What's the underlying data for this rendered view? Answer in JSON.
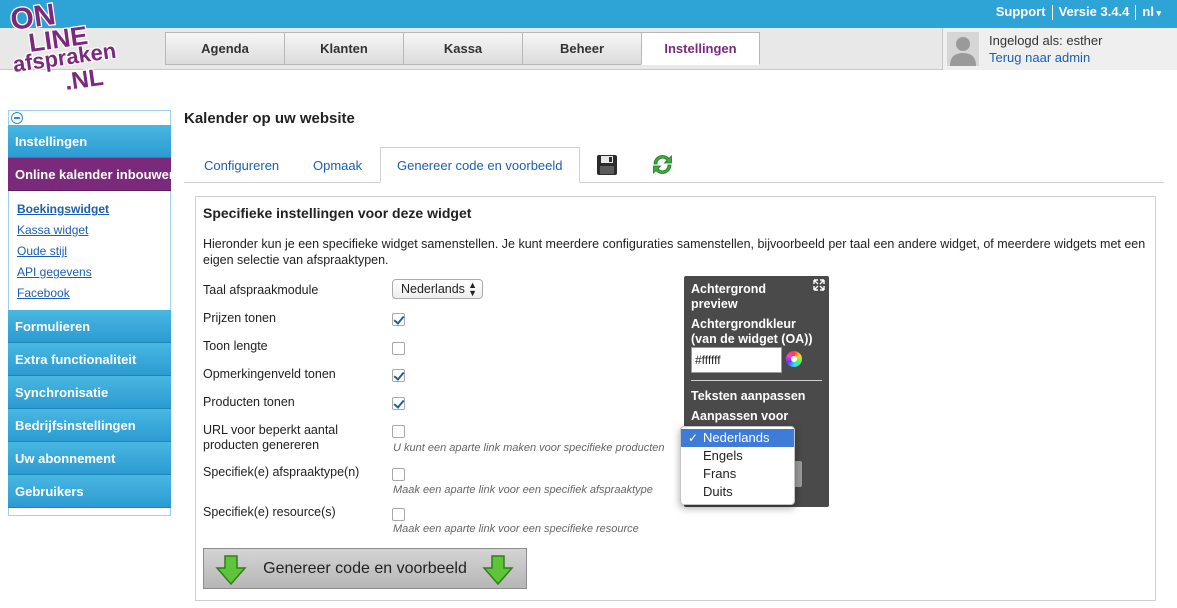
{
  "topbar": {
    "support": "Support",
    "version": "Versie 3.4.4",
    "language": "nl"
  },
  "logo": {
    "line1": "ON",
    "line2": "LINE",
    "line3": "afspraken",
    "line4": ".NL"
  },
  "nav": {
    "tabs": [
      "Agenda",
      "Klanten",
      "Kassa",
      "Beheer",
      "Instellingen"
    ],
    "active_tab": "Instellingen"
  },
  "user": {
    "logged_in": "Ingelogd als: esther",
    "back_to_admin": "Terug naar admin"
  },
  "sidebar": {
    "sections": [
      {
        "label": "Instellingen"
      },
      {
        "label": "Online kalender inbouwen",
        "active": true
      }
    ],
    "subitems": [
      "Boekingswidget",
      "Kassa widget",
      "Oude stijl",
      "API gegevens",
      "Facebook"
    ],
    "more_sections": [
      "Formulieren",
      "Extra functionaliteit",
      "Synchronisatie",
      "Bedrijfsinstellingen",
      "Uw abonnement",
      "Gebruikers"
    ]
  },
  "page": {
    "title": "Kalender op uw website",
    "subtabs": [
      "Configureren",
      "Opmaak",
      "Genereer code en voorbeeld"
    ],
    "active_subtab": "Genereer code en voorbeeld"
  },
  "panel": {
    "heading": "Specifieke instellingen voor deze widget",
    "intro": "Hieronder kun je een specifieke widget samenstellen. Je kunt meerdere configuraties samenstellen, bijvoorbeeld per taal een andere widget, of meerdere widgets met een eigen selectie van afspraaktypen.",
    "language_label": "Taal afspraakmodule",
    "language_value": "Nederlands",
    "options": [
      {
        "label": "Prijzen tonen",
        "checked": true
      },
      {
        "label": "Toon lengte",
        "checked": false
      },
      {
        "label": "Opmerkingenveld tonen",
        "checked": true
      },
      {
        "label": "Producten tonen",
        "checked": true
      },
      {
        "label": "URL voor beperkt aantal producten genereren",
        "checked": false,
        "hint": "U kunt een aparte link maken voor specifieke producten"
      },
      {
        "label": "Specifiek(e) afspraaktype(n)",
        "checked": false,
        "hint": "Maak een aparte link voor een specifiek afspraaktype"
      },
      {
        "label": "Specifiek(e) resource(s)",
        "checked": false,
        "hint": "Maak een aparte link voor een specifieke resource"
      }
    ],
    "generate_button": "Genereer code en voorbeeld"
  },
  "preview_panel": {
    "title": "Achtergrond preview",
    "bg_label": "Achtergrondkleur (van de widget (OA))",
    "bg_value": "#ffffff",
    "texts_heading": "Teksten aanpassen",
    "customize_for": "Aanpassen voor"
  },
  "language_dropdown": {
    "options": [
      "Nederlands",
      "Engels",
      "Frans",
      "Duits"
    ],
    "selected": "Nederlands"
  },
  "colors": {
    "topbar": "#2ea3d6",
    "sidebar_active": "#7b2a7b",
    "link": "#1a5fb4"
  }
}
